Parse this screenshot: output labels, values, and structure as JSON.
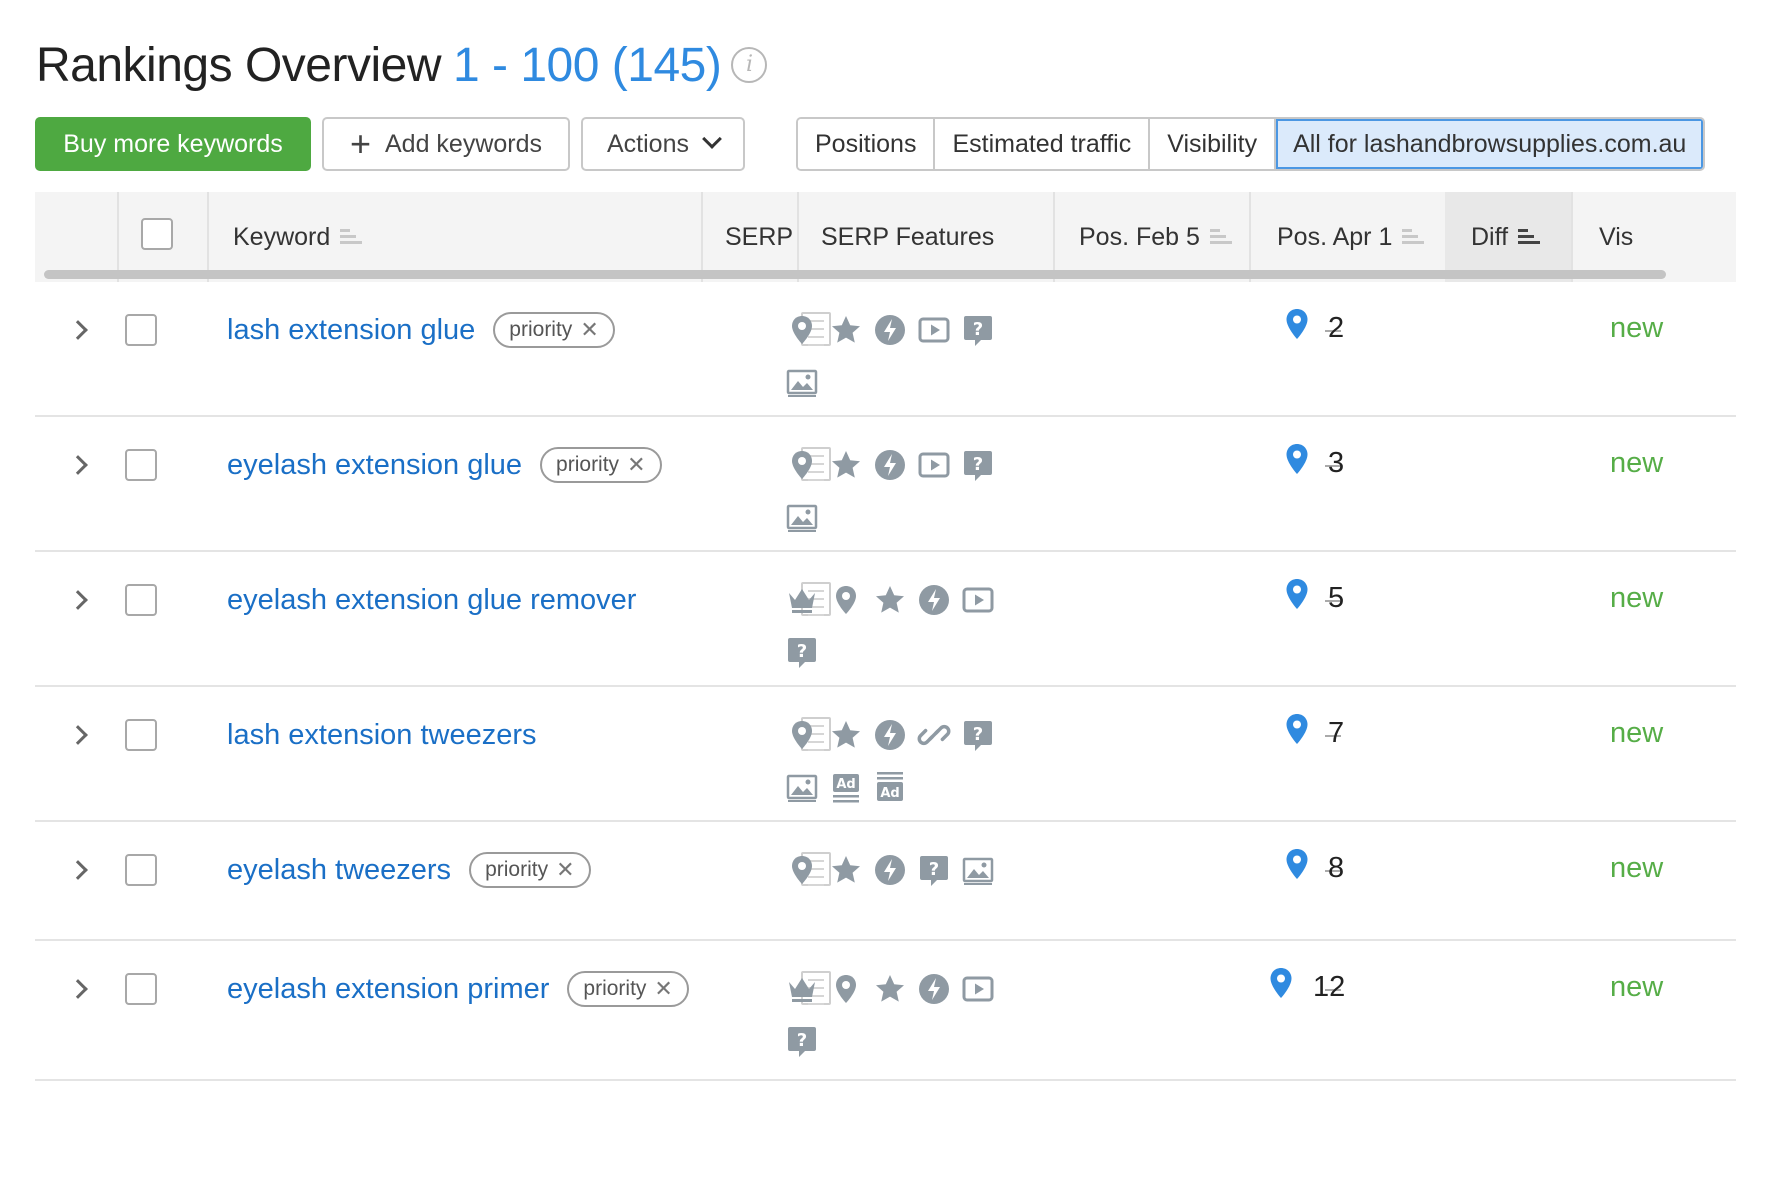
{
  "header": {
    "title": "Rankings Overview",
    "range": "1 - 100 (145)",
    "info_icon": "i"
  },
  "toolbar": {
    "buy_label": "Buy more keywords",
    "add_label": "Add keywords",
    "actions_label": "Actions",
    "tabs": [
      {
        "label": "Positions",
        "active": false
      },
      {
        "label": "Estimated traffic",
        "active": false
      },
      {
        "label": "Visibility",
        "active": false
      },
      {
        "label": "All for lashandbrowsupplies.com.au",
        "active": true
      }
    ]
  },
  "table": {
    "columns": {
      "keyword": "Keyword",
      "serp": "SERP",
      "serp_features": "SERP Features",
      "pos_feb": "Pos. Feb 5",
      "pos_apr": "Pos. Apr 1",
      "diff": "Diff",
      "vis": "Vis"
    },
    "rows": [
      {
        "keyword": "lash extension glue",
        "tag": "priority",
        "features": [
          "local-pack",
          "reviews",
          "amp",
          "video",
          "people-also-ask",
          "image"
        ],
        "pos_feb": "–",
        "pos_apr": "2",
        "diff": "new"
      },
      {
        "keyword": "eyelash extension glue",
        "tag": "priority",
        "features": [
          "local-pack",
          "reviews",
          "amp",
          "video",
          "people-also-ask",
          "image"
        ],
        "pos_feb": "–",
        "pos_apr": "3",
        "diff": "new"
      },
      {
        "keyword": "eyelash extension glue remover",
        "tag": "",
        "features": [
          "top-stories",
          "local-pack",
          "reviews",
          "amp",
          "video",
          "people-also-ask"
        ],
        "pos_feb": "–",
        "pos_apr": "5",
        "diff": "new"
      },
      {
        "keyword": "lash extension tweezers",
        "tag": "",
        "features": [
          "local-pack",
          "reviews",
          "amp",
          "sitelinks",
          "people-also-ask",
          "image",
          "ads-top",
          "ads-bottom"
        ],
        "pos_feb": "–",
        "pos_apr": "7",
        "diff": "new"
      },
      {
        "keyword": "eyelash tweezers",
        "tag": "priority",
        "features": [
          "local-pack",
          "reviews",
          "amp",
          "people-also-ask",
          "image"
        ],
        "pos_feb": "–",
        "pos_apr": "8",
        "diff": "new"
      },
      {
        "keyword": "eyelash extension primer",
        "tag": "priority",
        "features": [
          "top-stories",
          "local-pack",
          "reviews",
          "amp",
          "video",
          "people-also-ask"
        ],
        "pos_feb": "–",
        "pos_apr": "12",
        "diff": "new"
      }
    ]
  },
  "colors": {
    "accent_blue": "#2f8ae0",
    "link_blue": "#1a6fc6",
    "buy_green": "#4ea941",
    "diff_green": "#56ad47",
    "icon_gray": "#8f9aa3",
    "active_tab_bg": "#dbeafb"
  }
}
